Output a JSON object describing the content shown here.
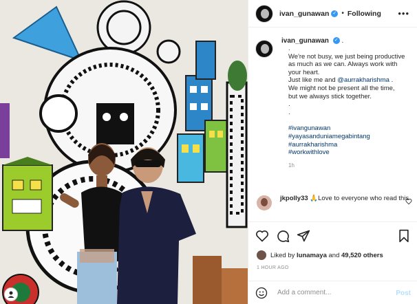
{
  "post": {
    "username": "ivan_gunawan",
    "verified_mark": "✓",
    "separator": "•",
    "follow_status": "Following",
    "more_icon": "more-horizontal-icon",
    "caption": {
      "username": "ivan_gunawan",
      "after_name": ".",
      "lines": [
        ".",
        "We're not busy, we just being productive",
        "as much as we can. Always work with",
        "your heart.",
        "Just like me and ",
        "We might not be present all the time,",
        "but we always stick together.",
        ".",
        "."
      ],
      "mention": "@aurrakharishma",
      "mention_after": " .",
      "hashtags": [
        "#ivangunawan",
        "#yayasanduniamegabintang",
        "#aurrakharishma",
        "#workwithlove"
      ],
      "time": "1h"
    },
    "comment": {
      "username": "jkpolly33",
      "text": " 🙏Love to everyone who read this"
    },
    "likes": {
      "prefix": "Liked by ",
      "first_user": "lunamaya",
      "middle": " and ",
      "count": "49,520 others"
    },
    "posted_ago": "1 HOUR AGO",
    "add_comment": {
      "placeholder": "Add a comment...",
      "post_label": "Post"
    }
  },
  "colors": {
    "link": "#00376b",
    "verified": "#3897f0",
    "post_disabled": "#b2dffc",
    "muted": "#8e8e8e"
  }
}
